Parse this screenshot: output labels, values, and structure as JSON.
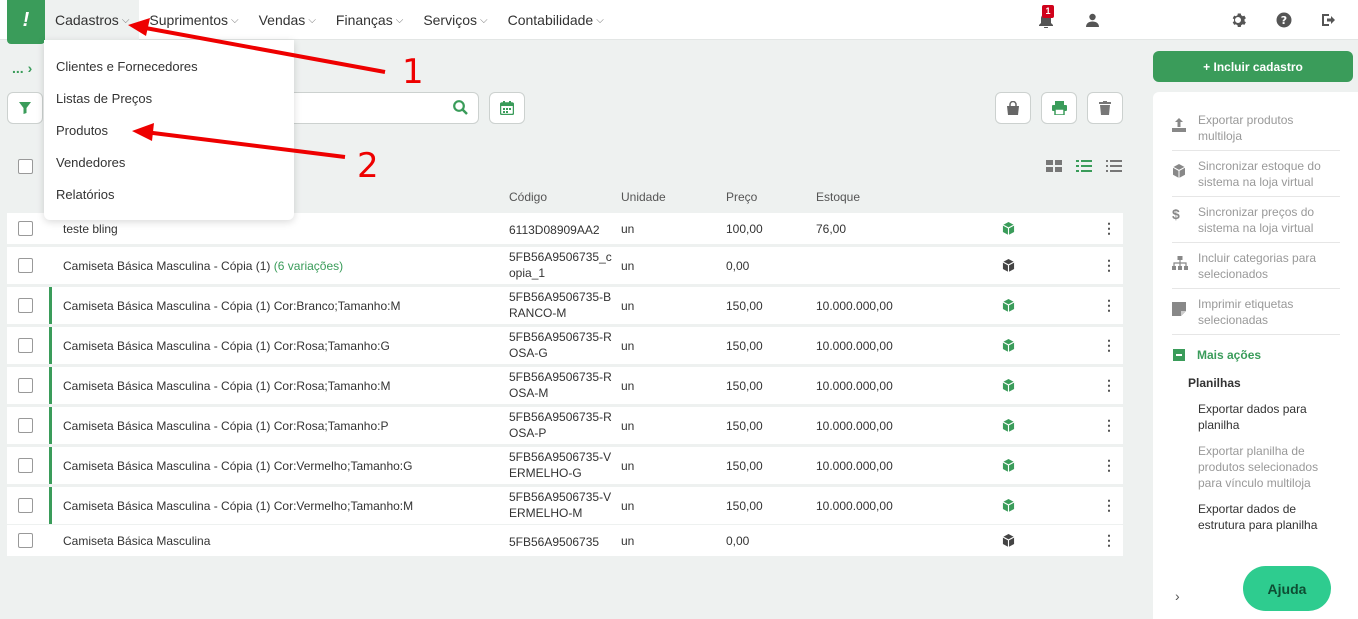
{
  "nav": {
    "logo": "!",
    "items": [
      {
        "label": "Cadastros"
      },
      {
        "label": "Suprimentos"
      },
      {
        "label": "Vendas"
      },
      {
        "label": "Finanças"
      },
      {
        "label": "Serviços"
      },
      {
        "label": "Contabilidade"
      }
    ],
    "notification_count": "1"
  },
  "dropdown": {
    "items": [
      {
        "label": "Clientes e Fornecedores"
      },
      {
        "label": "Listas de Preços"
      },
      {
        "label": "Produtos"
      },
      {
        "label": "Vendedores"
      },
      {
        "label": "Relatórios"
      }
    ]
  },
  "annotations": {
    "one": "1",
    "two": "2"
  },
  "breadcrumb": "...",
  "table": {
    "headers": {
      "code": "Código",
      "unit": "Unidade",
      "price": "Preço",
      "stock": "Estoque"
    },
    "rows": [
      {
        "desc": "teste bling",
        "variations": "",
        "code": "6113D08909AA2",
        "unit": "un",
        "price": "100,00",
        "stock": "76,00",
        "variant": false,
        "cube": "green"
      },
      {
        "desc": "Camiseta Básica Masculina - Cópia (1)",
        "variations": "(6 variações)",
        "code": "5FB56A9506735_copia_1",
        "unit": "un",
        "price": "0,00",
        "stock": "",
        "variant": false,
        "cube": "dark"
      },
      {
        "desc": "Camiseta Básica Masculina - Cópia (1) Cor:Branco;Tamanho:M",
        "variations": "",
        "code": "5FB56A9506735-BRANCO-M",
        "unit": "un",
        "price": "150,00",
        "stock": "10.000.000,00",
        "variant": true,
        "cube": "green"
      },
      {
        "desc": "Camiseta Básica Masculina - Cópia (1) Cor:Rosa;Tamanho:G",
        "variations": "",
        "code": "5FB56A9506735-ROSA-G",
        "unit": "un",
        "price": "150,00",
        "stock": "10.000.000,00",
        "variant": true,
        "cube": "green"
      },
      {
        "desc": "Camiseta Básica Masculina - Cópia (1) Cor:Rosa;Tamanho:M",
        "variations": "",
        "code": "5FB56A9506735-ROSA-M",
        "unit": "un",
        "price": "150,00",
        "stock": "10.000.000,00",
        "variant": true,
        "cube": "green"
      },
      {
        "desc": "Camiseta Básica Masculina - Cópia (1) Cor:Rosa;Tamanho:P",
        "variations": "",
        "code": "5FB56A9506735-ROSA-P",
        "unit": "un",
        "price": "150,00",
        "stock": "10.000.000,00",
        "variant": true,
        "cube": "green"
      },
      {
        "desc": "Camiseta Básica Masculina - Cópia (1) Cor:Vermelho;Tamanho:G",
        "variations": "",
        "code": "5FB56A9506735-VERMELHO-G",
        "unit": "un",
        "price": "150,00",
        "stock": "10.000.000,00",
        "variant": true,
        "cube": "green"
      },
      {
        "desc": "Camiseta Básica Masculina - Cópia (1) Cor:Vermelho;Tamanho:M",
        "variations": "",
        "code": "5FB56A9506735-VERMELHO-M",
        "unit": "un",
        "price": "150,00",
        "stock": "10.000.000,00",
        "variant": true,
        "cube": "green"
      },
      {
        "desc": "Camiseta Básica Masculina",
        "variations": "",
        "code": "5FB56A9506735",
        "unit": "un",
        "price": "0,00",
        "stock": "",
        "variant": false,
        "cube": "dark"
      }
    ]
  },
  "panel": {
    "include_label": "+ Incluir cadastro",
    "actions": [
      {
        "label": "Exportar produtos multiloja",
        "icon": "upload-icon"
      },
      {
        "label": "Sincronizar estoque do sistema na loja virtual",
        "icon": "cube-icon"
      },
      {
        "label": "Sincronizar preços do sistema na loja virtual",
        "icon": "dollar-icon"
      },
      {
        "label": "Incluir categorias para selecionados",
        "icon": "hierarchy-icon"
      },
      {
        "label": "Imprimir etiquetas selecionadas",
        "icon": "label-icon"
      }
    ],
    "more_actions": "Mais ações",
    "sheets_heading": "Planilhas",
    "sheet_items": [
      {
        "label": "Exportar dados para planilha",
        "enabled": true
      },
      {
        "label": "Exportar planilha de produtos selecionados para vínculo multiloja",
        "enabled": false
      },
      {
        "label": "Exportar dados de estrutura para planilha",
        "enabled": true
      }
    ],
    "help_label": "Ajuda"
  },
  "colors": {
    "brand": "#3a9c5a",
    "annotation": "#e00000",
    "help": "#2ecc8f"
  }
}
